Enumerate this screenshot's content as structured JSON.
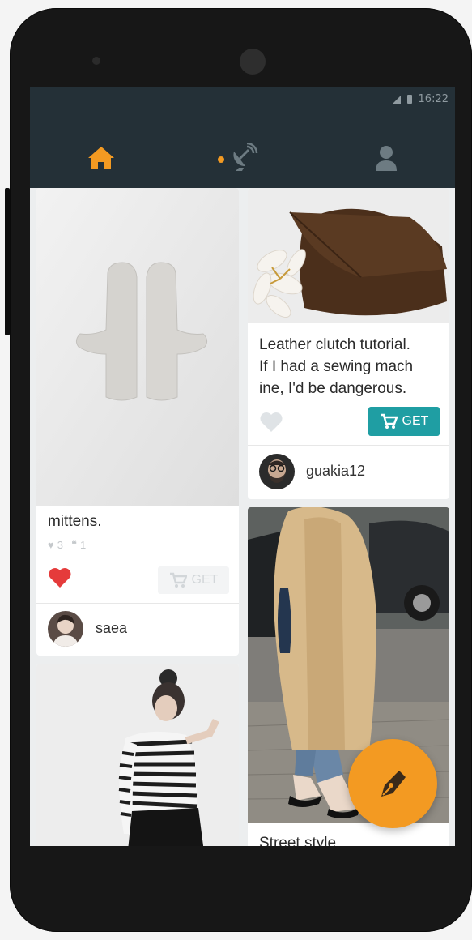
{
  "status_bar": {
    "time": "16:22"
  },
  "nav": {
    "home_icon": "home-icon",
    "feed_icon": "satellite-dish-icon",
    "profile_icon": "person-icon",
    "active_color": "#f39a22",
    "inactive_color": "#6d7b82"
  },
  "cards": [
    {
      "title": "mittens.",
      "likes": "3",
      "comments": "1",
      "liked": true,
      "get_label": "GET",
      "get_enabled": false,
      "username": "saea"
    },
    {
      "title": "Leather clutch tutorial.",
      "title_line2": "If I had a sewing mach",
      "title_line3": "ine, I'd be dangerous.",
      "liked": false,
      "get_label": "GET",
      "get_enabled": true,
      "username": "guakia12"
    },
    {
      "title": "Street style"
    }
  ],
  "fab": {
    "icon": "pen-nib-icon",
    "color": "#f39a22"
  },
  "colors": {
    "app_bar": "#243037",
    "accent": "#f39a22",
    "teal": "#1f9ea3",
    "like_red": "#e53b3b"
  }
}
